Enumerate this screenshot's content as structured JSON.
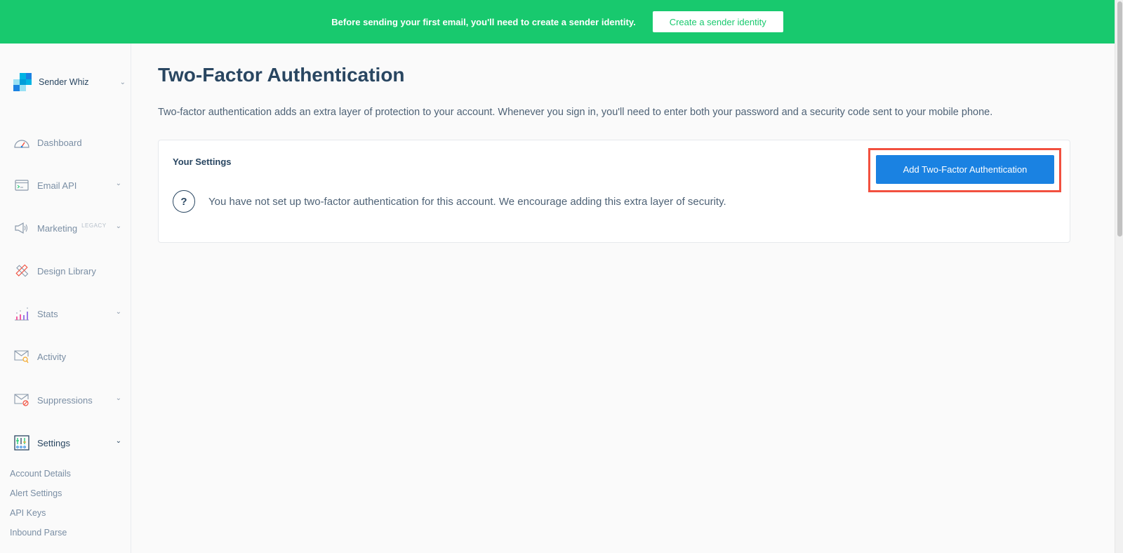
{
  "banner": {
    "message": "Before sending your first email, you'll need to create a sender identity.",
    "button_label": "Create a sender identity"
  },
  "sidebar": {
    "account_name": "Sender Whiz",
    "items": [
      {
        "label": "Dashboard",
        "icon": "dashboard-gauge-icon",
        "has_chevron": false
      },
      {
        "label": "Email API",
        "icon": "email-api-terminal-icon",
        "has_chevron": true
      },
      {
        "label": "Marketing",
        "badge": "LEGACY",
        "icon": "megaphone-icon",
        "has_chevron": true
      },
      {
        "label": "Design Library",
        "icon": "design-pencil-ruler-icon",
        "has_chevron": false
      },
      {
        "label": "Stats",
        "icon": "stats-bar-chart-icon",
        "has_chevron": true
      },
      {
        "label": "Activity",
        "icon": "activity-envelope-search-icon",
        "has_chevron": false
      },
      {
        "label": "Suppressions",
        "icon": "suppressions-envelope-block-icon",
        "has_chevron": true
      },
      {
        "label": "Settings",
        "icon": "settings-sliders-icon",
        "has_chevron": true,
        "active": true
      }
    ],
    "settings_subitems": [
      "Account Details",
      "Alert Settings",
      "API Keys",
      "Inbound Parse"
    ]
  },
  "main": {
    "title": "Two-Factor Authentication",
    "description": "Two-factor authentication adds an extra layer of protection to your account. Whenever you sign in, you'll need to enter both your password and a security code sent to your mobile phone.",
    "card": {
      "heading": "Your Settings",
      "button_label": "Add Two-Factor Authentication",
      "info_icon": "question-circle-icon",
      "info_text": "You have not set up two-factor authentication for this account. We encourage adding this extra layer of security."
    }
  },
  "colors": {
    "banner": "#18c96e",
    "primary": "#1a82e2",
    "highlight": "#f2503f",
    "text": "#294661"
  }
}
